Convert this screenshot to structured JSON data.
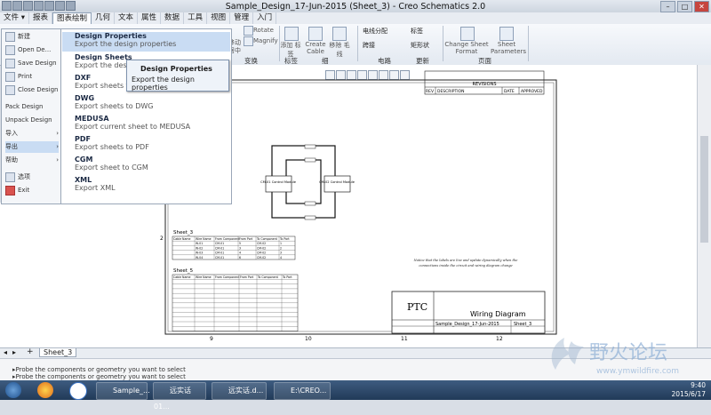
{
  "window": {
    "title": "Sample_Design_17-Jun-2015 (Sheet_3) - Creo Schematics 2.0"
  },
  "tabs": [
    "文件 ▾",
    "报表",
    "图表绘制",
    "几何",
    "文本",
    "属性",
    "数据",
    "工具",
    "视图",
    "管理",
    "入门"
  ],
  "ribbon": {
    "items": [
      "Rotate",
      "Magnify",
      "添加 标签",
      "Create Cable",
      "移除 毛线",
      "电线分配",
      "标签",
      "跨接",
      "矩形状",
      "Change Sheet Format",
      "Sheet Parameters"
    ],
    "groups": [
      "变换",
      "标签",
      "电路",
      "细",
      "更新",
      "页面"
    ],
    "fragments": [
      "移动",
      "居中"
    ]
  },
  "app_menu": {
    "items": [
      "新建",
      "Open De...",
      "Save Design",
      "Print",
      "Close Design",
      "Pack Design",
      "Unpack Design",
      "导入",
      "导出",
      "帮助",
      "选项",
      "Exit"
    ]
  },
  "export_submenu": [
    {
      "title": "Design Properties",
      "desc": "Export the design properties"
    },
    {
      "title": "Design Sheets",
      "desc": "Export the design"
    },
    {
      "title": "DXF",
      "desc": "Export sheets to"
    },
    {
      "title": "DWG",
      "desc": "Export sheets to DWG"
    },
    {
      "title": "MEDUSA",
      "desc": "Export current sheet to MEDUSA"
    },
    {
      "title": "PDF",
      "desc": "Export sheets to PDF"
    },
    {
      "title": "CGM",
      "desc": "Export sheet to CGM"
    },
    {
      "title": "XML",
      "desc": "Export XML"
    }
  ],
  "tooltip": {
    "title": "Design Properties",
    "desc": "Export the design properties"
  },
  "drawing": {
    "revisions_title": "REVISIONS",
    "rev_cols": [
      "REV",
      "DESCRIPTION",
      "DATE",
      "APPROVED"
    ],
    "grid_left": [
      "2"
    ],
    "grid_bottom": [
      "9",
      "10",
      "11",
      "12"
    ],
    "cm1_label": "CM-01 Control Module",
    "cm2_label": "CM-02 Control Module",
    "table1_title": "Sheet_3",
    "table1_cols": [
      "Cable Name",
      "Wire Name",
      "From Component",
      "From Port",
      "To Component",
      "To Port"
    ],
    "table1_rows": [
      [
        "",
        "W-01",
        "CM-01",
        "5",
        "CM-02",
        "1"
      ],
      [
        "",
        "W-02",
        "CM-01",
        "3",
        "CM-02",
        "2"
      ],
      [
        "",
        "W-03",
        "CM-01",
        "4",
        "CM-02",
        "3"
      ],
      [
        "",
        "W-04",
        "CM-01",
        "6",
        "CM-02",
        "4"
      ]
    ],
    "table2_title": "Sheet_5",
    "note": "Notice that the labels are live and update dynamically when the connections inside the circuit and wiring diagram change",
    "title_block": {
      "logo": "PTC",
      "title": "Wiring Diagram",
      "design": "Sample_Design_17-Jun-2015",
      "sheet": "Sheet_3"
    }
  },
  "sheet_tab": "Sheet_3",
  "messages": [
    "Probe the components or geometry you want to select",
    "Probe the components or geometry you want to select"
  ],
  "taskbar": {
    "items": [
      "Sample_...",
      "远实话01...",
      "远实话.d...",
      "E:\\CREO..."
    ],
    "time": "9:40",
    "date": "2015/6/17"
  },
  "watermark": {
    "text": "野火论坛",
    "url": "www.ymwildfire.com"
  },
  "colors": {
    "menu_highlight": "#c9dcf3",
    "taskbar": "#2b4567"
  }
}
